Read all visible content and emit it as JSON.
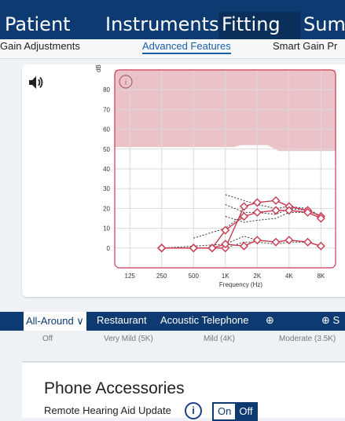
{
  "nav": {
    "tabs": [
      {
        "label": "Patient"
      },
      {
        "label": "Instruments"
      },
      {
        "label": "Fitting",
        "active": true
      },
      {
        "label": "Sum"
      }
    ]
  },
  "subnav": {
    "tabs": [
      {
        "label": "Gain Adjustments"
      },
      {
        "label": "Advanced Features",
        "active": true
      },
      {
        "label": "Smart Gain Pr"
      }
    ]
  },
  "chart_card": {
    "speaker_icon": "speaker-volume-icon",
    "info_icon": "info-circle-icon"
  },
  "chart_data": {
    "type": "line",
    "xlabel": "Frequency (Hz)",
    "ylabel": "dB",
    "x_scale": "log",
    "x_ticks": [
      {
        "v": 125,
        "label": "125"
      },
      {
        "v": 250,
        "label": "250"
      },
      {
        "v": 500,
        "label": "500"
      },
      {
        "v": 1000,
        "label": "1K"
      },
      {
        "v": 2000,
        "label": "2K"
      },
      {
        "v": 4000,
        "label": "4K"
      },
      {
        "v": 8000,
        "label": "8K"
      }
    ],
    "y_ticks": [
      0,
      10,
      20,
      30,
      40,
      50,
      60,
      70,
      80
    ],
    "ylim": [
      -10,
      90
    ],
    "xlim": [
      90,
      11000
    ],
    "shaded_region_lower": [
      {
        "x": 90,
        "y": 51
      },
      {
        "x": 1200,
        "y": 51
      },
      {
        "x": 1400,
        "y": 52
      },
      {
        "x": 2500,
        "y": 52
      },
      {
        "x": 3200,
        "y": 49
      },
      {
        "x": 11000,
        "y": 49
      }
    ],
    "target_series": [
      {
        "name": "",
        "x": [
          1000,
          1500,
          2000,
          3000,
          4000,
          6000,
          8000
        ],
        "y": [
          27,
          24,
          22,
          20,
          21,
          20,
          16
        ]
      },
      {
        "name": "",
        "x": [
          1000,
          1500,
          2000,
          3000,
          4000,
          6000,
          8000
        ],
        "y": [
          22,
          18,
          18,
          17,
          20,
          19,
          16
        ]
      },
      {
        "name": "",
        "x": [
          1000,
          1500,
          2000,
          3000,
          4000,
          6000,
          8000
        ],
        "y": [
          16,
          13,
          14,
          15,
          18,
          18,
          15
        ]
      },
      {
        "name": "",
        "x": [
          500,
          1000,
          1500
        ],
        "y": [
          5,
          10,
          17
        ]
      },
      {
        "name": "",
        "x": [
          250,
          500,
          1000,
          1500,
          2000,
          3000,
          4000,
          6000,
          8000
        ],
        "y": [
          0,
          1,
          2,
          6,
          4,
          3,
          4,
          3,
          1
        ]
      },
      {
        "name": "",
        "x": [
          250,
          500,
          1000,
          1500,
          2000,
          3000,
          4000,
          6000,
          8000
        ],
        "y": [
          0,
          0,
          0,
          3,
          3,
          2,
          3,
          3,
          1
        ]
      }
    ],
    "series": [
      {
        "name": "",
        "x": [
          250,
          500,
          750,
          1000,
          1500,
          2000,
          3000,
          4000,
          6000,
          8000
        ],
        "y": [
          0,
          0,
          0,
          0,
          21,
          23,
          24,
          21,
          19,
          16
        ]
      },
      {
        "name": "",
        "x": [
          250,
          500,
          750,
          1000,
          1500,
          2000,
          3000,
          4000,
          6000,
          8000
        ],
        "y": [
          0,
          0,
          0,
          9,
          16,
          18,
          19,
          19,
          18,
          15
        ]
      },
      {
        "name": "",
        "x": [
          250,
          500,
          750,
          1000,
          1500,
          2000,
          3000,
          4000,
          6000,
          8000
        ],
        "y": [
          0,
          0,
          0,
          2,
          1,
          4,
          3,
          4,
          3,
          1
        ]
      }
    ]
  },
  "program_tabs": [
    {
      "label": "All-Around ∨",
      "active": true
    },
    {
      "label": "Restaurant"
    },
    {
      "label": "Acoustic Telephone"
    },
    {
      "label": "⊕"
    },
    {
      "label": "⊕  S"
    }
  ],
  "levels": [
    {
      "label": "Off"
    },
    {
      "label": "Very Mild (5K)"
    },
    {
      "label": "Mild (4K)"
    },
    {
      "label": "Moderate (3.5K)"
    }
  ],
  "accessories": {
    "title": "Phone Accessories",
    "rhau_label": "Remote Hearing Aid Update",
    "info_label": "i",
    "toggle_on": "On",
    "toggle_off": "Off",
    "toggle_state": "Off"
  },
  "colors": {
    "nav_bg": "#0d3a70",
    "accent": "#1b5fa8",
    "curve": "#c8394f",
    "shade": "#ecc2c9"
  }
}
